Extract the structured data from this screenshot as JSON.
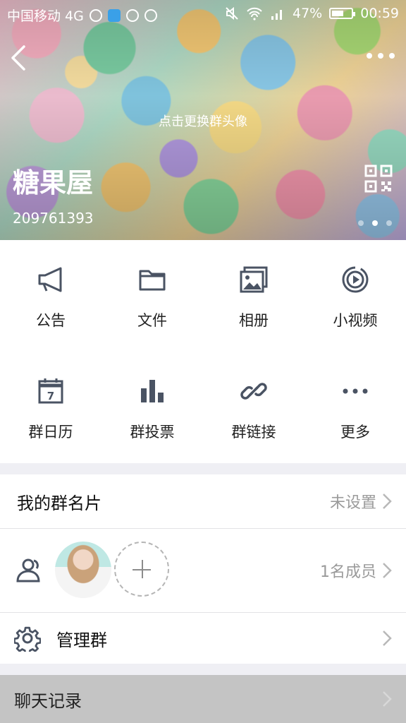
{
  "status_bar": {
    "carrier": "中国移动 4G",
    "battery_percent": "47%",
    "time": "00:59"
  },
  "header": {
    "avatar_hint": "点击更换群头像",
    "group_name": "糖果屋",
    "group_id": "209761393"
  },
  "features": [
    {
      "label": "公告",
      "icon": "megaphone-icon"
    },
    {
      "label": "文件",
      "icon": "folder-icon"
    },
    {
      "label": "相册",
      "icon": "album-icon"
    },
    {
      "label": "小视频",
      "icon": "video-icon"
    },
    {
      "label": "群日历",
      "icon": "calendar-icon",
      "day": "7"
    },
    {
      "label": "群投票",
      "icon": "bar-chart-icon"
    },
    {
      "label": "群链接",
      "icon": "link-icon"
    },
    {
      "label": "更多",
      "icon": "more-icon"
    }
  ],
  "card_row": {
    "title": "我的群名片",
    "value": "未设置"
  },
  "member_row": {
    "count": "1名成员"
  },
  "manage_row": {
    "title": "管理群"
  },
  "history_row": {
    "title": "聊天记录"
  },
  "colors": {
    "icon": "#4a5363",
    "chevron": "#b8b8b8",
    "background": "#efeff4"
  }
}
